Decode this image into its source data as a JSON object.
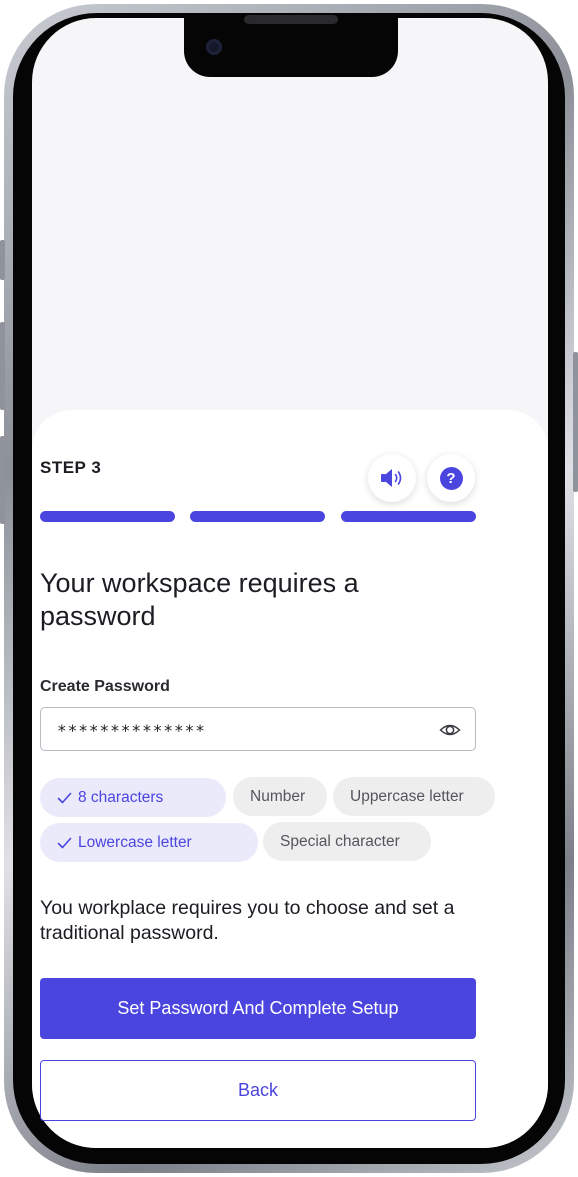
{
  "step": {
    "label": "STEP 3",
    "total_steps": 3,
    "completed_steps": 3
  },
  "toolbar": {
    "audio_icon": "speaker-icon",
    "help_icon": "question-mark-icon",
    "help_glyph": "?"
  },
  "main": {
    "heading": "Your workspace requires a password",
    "password_field": {
      "label": "Create Password",
      "value": "**************",
      "toggle_icon": "eye-icon"
    },
    "requirements": [
      {
        "label": "8 characters",
        "met": true
      },
      {
        "label": "Number",
        "met": false
      },
      {
        "label": "Uppercase letter",
        "met": false
      },
      {
        "label": "Lowercase letter",
        "met": true
      },
      {
        "label": "Special character",
        "met": false
      }
    ],
    "info_text": "You workplace requires you to choose and set a traditional password.",
    "primary_button": "Set Password And Complete Setup",
    "secondary_button": "Back"
  },
  "colors": {
    "accent": "#4b45e0",
    "chip_met_bg": "#ebeafb",
    "chip_unmet_bg": "#eeeeef",
    "text": "#1c1c22"
  }
}
